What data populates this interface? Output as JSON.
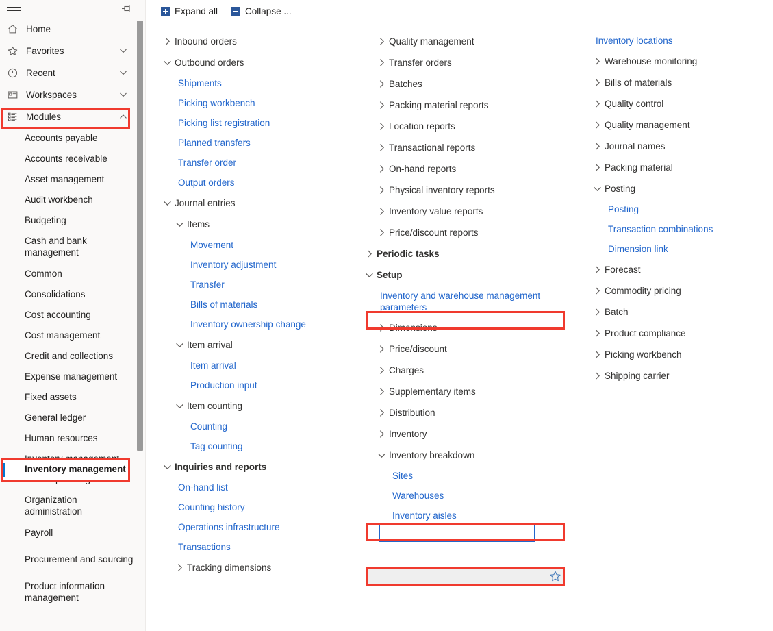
{
  "app": {
    "accent_blue": "#2266cc",
    "highlight_red": "#f03a2e",
    "sidebar_bg": "#faf9f8",
    "selected_row_bg": "#efefef"
  },
  "sidebar": {
    "hamburger_label": "navigation-menu",
    "pin_label": "pin-navigation",
    "nav_items": [
      {
        "label": "Home",
        "icon": "home-icon",
        "chevron": "none"
      },
      {
        "label": "Favorites",
        "icon": "star-icon",
        "chevron": "down"
      },
      {
        "label": "Recent",
        "icon": "clock-icon",
        "chevron": "down"
      },
      {
        "label": "Workspaces",
        "icon": "workspaces-icon",
        "chevron": "down"
      },
      {
        "label": "Modules",
        "icon": "modules-icon",
        "chevron": "up"
      }
    ],
    "modules": [
      {
        "label": "Accounts payable",
        "selected": false
      },
      {
        "label": "Accounts receivable",
        "selected": false
      },
      {
        "label": "Asset management",
        "selected": false
      },
      {
        "label": "Audit workbench",
        "selected": false
      },
      {
        "label": "Budgeting",
        "selected": false
      },
      {
        "label": "Cash and bank management",
        "selected": false
      },
      {
        "label": "Common",
        "selected": false
      },
      {
        "label": "Consolidations",
        "selected": false
      },
      {
        "label": "Cost accounting",
        "selected": false
      },
      {
        "label": "Cost management",
        "selected": false
      },
      {
        "label": "Credit and collections",
        "selected": false
      },
      {
        "label": "Expense management",
        "selected": false
      },
      {
        "label": "Fixed assets",
        "selected": false
      },
      {
        "label": "General ledger",
        "selected": false
      },
      {
        "label": "Human resources",
        "selected": false
      },
      {
        "label": "Inventory management",
        "selected": true
      },
      {
        "label": "Master planning",
        "selected": false
      },
      {
        "label": "Organization administration",
        "selected": false
      },
      {
        "label": "Payroll",
        "selected": false
      },
      {
        "label": "Procurement and sourcing",
        "selected": false
      },
      {
        "label": "Product information management",
        "selected": false
      }
    ]
  },
  "toolbar": {
    "expand_all": "Expand all",
    "collapse_all": "Collapse ..."
  },
  "menu": {
    "column1": [
      {
        "type": "group",
        "label": "Inbound orders",
        "state": "collapsed",
        "indent": 0,
        "bold": false
      },
      {
        "type": "group",
        "label": "Outbound orders",
        "state": "expanded",
        "indent": 0,
        "bold": false
      },
      {
        "type": "link",
        "label": "Shipments",
        "indent": 1
      },
      {
        "type": "link",
        "label": "Picking workbench",
        "indent": 1
      },
      {
        "type": "link",
        "label": "Picking list registration",
        "indent": 1
      },
      {
        "type": "link",
        "label": "Planned transfers",
        "indent": 1
      },
      {
        "type": "link",
        "label": "Transfer order",
        "indent": 1
      },
      {
        "type": "link",
        "label": "Output orders",
        "indent": 1
      },
      {
        "type": "group",
        "label": "Journal entries",
        "state": "expanded",
        "indent": 0,
        "bold": false
      },
      {
        "type": "group",
        "label": "Items",
        "state": "expanded",
        "indent": 1,
        "bold": false
      },
      {
        "type": "link",
        "label": "Movement",
        "indent": 2
      },
      {
        "type": "link",
        "label": "Inventory adjustment",
        "indent": 2
      },
      {
        "type": "link",
        "label": "Transfer",
        "indent": 2
      },
      {
        "type": "link",
        "label": "Bills of materials",
        "indent": 2
      },
      {
        "type": "link",
        "label": "Inventory ownership change",
        "indent": 2
      },
      {
        "type": "group",
        "label": "Item arrival",
        "state": "expanded",
        "indent": 1,
        "bold": false
      },
      {
        "type": "link",
        "label": "Item arrival",
        "indent": 2
      },
      {
        "type": "link",
        "label": "Production input",
        "indent": 2
      },
      {
        "type": "group",
        "label": "Item counting",
        "state": "expanded",
        "indent": 1,
        "bold": false
      },
      {
        "type": "link",
        "label": "Counting",
        "indent": 2
      },
      {
        "type": "link",
        "label": "Tag counting",
        "indent": 2
      },
      {
        "type": "group",
        "label": "Inquiries and reports",
        "state": "expanded",
        "indent": 0,
        "bold": true
      },
      {
        "type": "link",
        "label": "On-hand list",
        "indent": 1
      },
      {
        "type": "link",
        "label": "Counting history",
        "indent": 1
      },
      {
        "type": "link",
        "label": "Operations infrastructure",
        "indent": 1
      },
      {
        "type": "link",
        "label": "Transactions",
        "indent": 1
      },
      {
        "type": "group",
        "label": "Tracking dimensions",
        "state": "collapsed",
        "indent": 1,
        "bold": false
      }
    ],
    "column2": [
      {
        "type": "group",
        "label": "Quality management",
        "state": "collapsed",
        "indent": 1,
        "bold": false
      },
      {
        "type": "group",
        "label": "Transfer orders",
        "state": "collapsed",
        "indent": 1,
        "bold": false
      },
      {
        "type": "group",
        "label": "Batches",
        "state": "collapsed",
        "indent": 1,
        "bold": false
      },
      {
        "type": "group",
        "label": "Packing material reports",
        "state": "collapsed",
        "indent": 1,
        "bold": false
      },
      {
        "type": "group",
        "label": "Location reports",
        "state": "collapsed",
        "indent": 1,
        "bold": false
      },
      {
        "type": "group",
        "label": "Transactional reports",
        "state": "collapsed",
        "indent": 1,
        "bold": false
      },
      {
        "type": "group",
        "label": "On-hand reports",
        "state": "collapsed",
        "indent": 1,
        "bold": false
      },
      {
        "type": "group",
        "label": "Physical inventory reports",
        "state": "collapsed",
        "indent": 1,
        "bold": false
      },
      {
        "type": "group",
        "label": "Inventory value reports",
        "state": "collapsed",
        "indent": 1,
        "bold": false
      },
      {
        "type": "group",
        "label": "Price/discount reports",
        "state": "collapsed",
        "indent": 1,
        "bold": false
      },
      {
        "type": "group",
        "label": "Periodic tasks",
        "state": "collapsed",
        "indent": 0,
        "bold": true
      },
      {
        "type": "group",
        "label": "Setup",
        "state": "expanded",
        "indent": 0,
        "bold": true,
        "highlight": "red-box"
      },
      {
        "type": "link",
        "label": "Inventory and warehouse management parameters",
        "indent": 1
      },
      {
        "type": "group",
        "label": "Dimensions",
        "state": "collapsed",
        "indent": 1,
        "bold": false
      },
      {
        "type": "group",
        "label": "Price/discount",
        "state": "collapsed",
        "indent": 1,
        "bold": false
      },
      {
        "type": "group",
        "label": "Charges",
        "state": "collapsed",
        "indent": 1,
        "bold": false
      },
      {
        "type": "group",
        "label": "Supplementary items",
        "state": "collapsed",
        "indent": 1,
        "bold": false
      },
      {
        "type": "group",
        "label": "Distribution",
        "state": "collapsed",
        "indent": 1,
        "bold": false
      },
      {
        "type": "group",
        "label": "Inventory",
        "state": "collapsed",
        "indent": 1,
        "bold": false
      },
      {
        "type": "group",
        "label": "Inventory breakdown",
        "state": "expanded",
        "indent": 1,
        "bold": false,
        "highlight": "red-box-focused"
      },
      {
        "type": "link",
        "label": "Sites",
        "indent": 2
      },
      {
        "type": "link",
        "label": "Warehouses",
        "indent": 2,
        "highlight": "red-box-selected",
        "starred": true
      },
      {
        "type": "link",
        "label": "Inventory aisles",
        "indent": 2
      }
    ],
    "column3": [
      {
        "type": "link",
        "label": "Inventory locations",
        "indent": 1
      },
      {
        "type": "group",
        "label": "Warehouse monitoring",
        "state": "collapsed",
        "indent": 1,
        "bold": false
      },
      {
        "type": "group",
        "label": "Bills of materials",
        "state": "collapsed",
        "indent": 1,
        "bold": false
      },
      {
        "type": "group",
        "label": "Quality control",
        "state": "collapsed",
        "indent": 1,
        "bold": false
      },
      {
        "type": "group",
        "label": "Quality management",
        "state": "collapsed",
        "indent": 1,
        "bold": false
      },
      {
        "type": "group",
        "label": "Journal names",
        "state": "collapsed",
        "indent": 1,
        "bold": false
      },
      {
        "type": "group",
        "label": "Packing material",
        "state": "collapsed",
        "indent": 1,
        "bold": false
      },
      {
        "type": "group",
        "label": "Posting",
        "state": "expanded",
        "indent": 1,
        "bold": false
      },
      {
        "type": "link",
        "label": "Posting",
        "indent": 2
      },
      {
        "type": "link",
        "label": "Transaction combinations",
        "indent": 2
      },
      {
        "type": "link",
        "label": "Dimension link",
        "indent": 2
      },
      {
        "type": "group",
        "label": "Forecast",
        "state": "collapsed",
        "indent": 1,
        "bold": false
      },
      {
        "type": "group",
        "label": "Commodity pricing",
        "state": "collapsed",
        "indent": 1,
        "bold": false
      },
      {
        "type": "group",
        "label": "Batch",
        "state": "collapsed",
        "indent": 1,
        "bold": false
      },
      {
        "type": "group",
        "label": "Product compliance",
        "state": "collapsed",
        "indent": 1,
        "bold": false
      },
      {
        "type": "group",
        "label": "Picking workbench",
        "state": "collapsed",
        "indent": 1,
        "bold": false
      },
      {
        "type": "group",
        "label": "Shipping carrier",
        "state": "collapsed",
        "indent": 1,
        "bold": false
      }
    ]
  }
}
